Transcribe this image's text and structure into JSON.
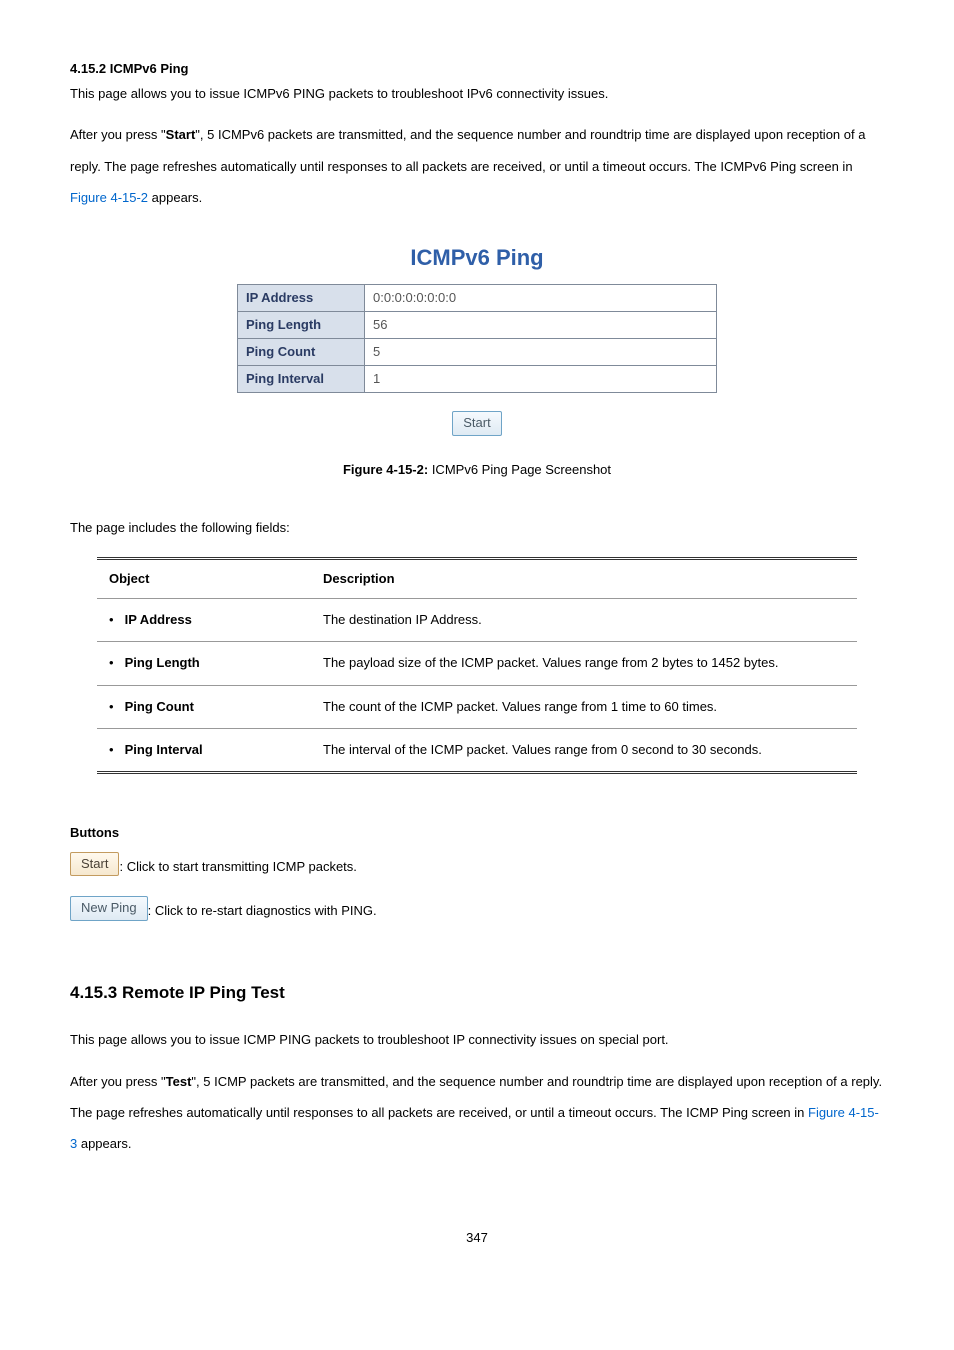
{
  "sec1": {
    "heading": "4.15.2 ICMPv6 Ping",
    "p1_a": "This page allows you to issue ICMPv6 PING packets to troubleshoot IPv6 connectivity issues.",
    "p1_b_pre": "After you press \"",
    "start_word": "Start",
    "p1_b_post": "\", 5 ICMPv6 packets are transmitted, and the sequence number and roundtrip time are displayed upon reception of a reply. The page refreshes automatically until responses to all packets are received, or until a timeout occurs. The ICMPv6 Ping screen in ",
    "fig_link": "Figure 4-15-2",
    "p1_b_end": " appears."
  },
  "ping_form": {
    "title": "ICMPv6 Ping",
    "rows": {
      "ip_label": "IP Address",
      "ip_value": "0:0:0:0:0:0:0:0",
      "len_label": "Ping Length",
      "len_value": "56",
      "cnt_label": "Ping Count",
      "cnt_value": "5",
      "int_label": "Ping Interval",
      "int_value": "1"
    },
    "start_btn": "Start"
  },
  "caption": {
    "fig": "Figure 4-15-2:",
    "text": " ICMPv6 Ping Page Screenshot"
  },
  "fields_intro": "The page includes the following fields:",
  "table": {
    "h_obj": "Object",
    "h_desc": "Description",
    "rows": [
      {
        "name": "IP Address",
        "desc": "The destination IP Address."
      },
      {
        "name": "Ping Length",
        "desc": "The payload size of the ICMP packet. Values range from 2 bytes to 1452 bytes."
      },
      {
        "name": "Ping Count",
        "desc": "The count of the ICMP packet. Values range from 1 time to 60 times."
      },
      {
        "name": "Ping Interval",
        "desc": "The interval of the ICMP packet. Values range from 0 second to 30 seconds."
      }
    ]
  },
  "buttons": {
    "heading": "Buttons",
    "start_label": "Start",
    "start_desc": ": Click to start transmitting ICMP packets.",
    "newping_label": "New Ping",
    "newping_desc": ": Click to re-start diagnostics with PING."
  },
  "sec2": {
    "heading": "4.15.3 Remote IP Ping Test",
    "p1": "This page allows you to issue ICMP PING packets to troubleshoot IP connectivity issues on special port.",
    "p2_pre": "After you press \"",
    "test_word": "Test",
    "p2_post": "\", 5 ICMP packets are transmitted, and the sequence number and roundtrip time are displayed upon reception of a reply. The page refreshes automatically until responses to all packets are received, or until a timeout occurs. The ICMP Ping screen in ",
    "fig_link": "Figure 4-15-3",
    "p2_end": " appears."
  },
  "page_num": "347"
}
